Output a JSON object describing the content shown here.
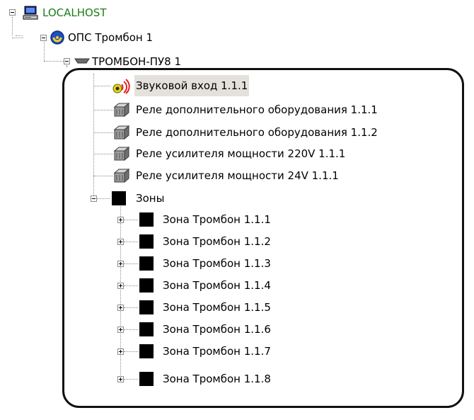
{
  "tree": {
    "host": {
      "label": "LOCALHOST",
      "icon": "computer-icon"
    },
    "system": {
      "label": "ОПС Тромбон 1",
      "icon": "device-ring-icon"
    },
    "panel": {
      "label": "ТРОМБОН-ПУ8 1",
      "icon": "panel-device-icon"
    },
    "items": [
      {
        "label": "Звуковой вход 1.1.1",
        "icon": "sound-input-icon",
        "selected": true
      },
      {
        "label": "Реле дополнительного оборудования 1.1.1",
        "icon": "relay-icon"
      },
      {
        "label": "Реле дополнительного оборудования 1.1.2",
        "icon": "relay-icon"
      },
      {
        "label": "Реле усилителя мощности 220V 1.1.1",
        "icon": "relay-icon"
      },
      {
        "label": "Реле усилителя мощности 24V 1.1.1",
        "icon": "relay-icon"
      }
    ],
    "zones_group": {
      "label": "Зоны",
      "icon": "zone-square-icon"
    },
    "zones": [
      "Зона Тромбон 1.1.1",
      "Зона Тромбон 1.1.2",
      "Зона Тромбон 1.1.3",
      "Зона Тромбон 1.1.4",
      "Зона Тромбон 1.1.5",
      "Зона Тромбон 1.1.6",
      "Зона Тромбон 1.1.7",
      "Зона Тромбон 1.1.8"
    ]
  },
  "colors": {
    "host_label": "#1a7d1a",
    "selection": "#e4e1dc",
    "callout_border": "#111111"
  }
}
